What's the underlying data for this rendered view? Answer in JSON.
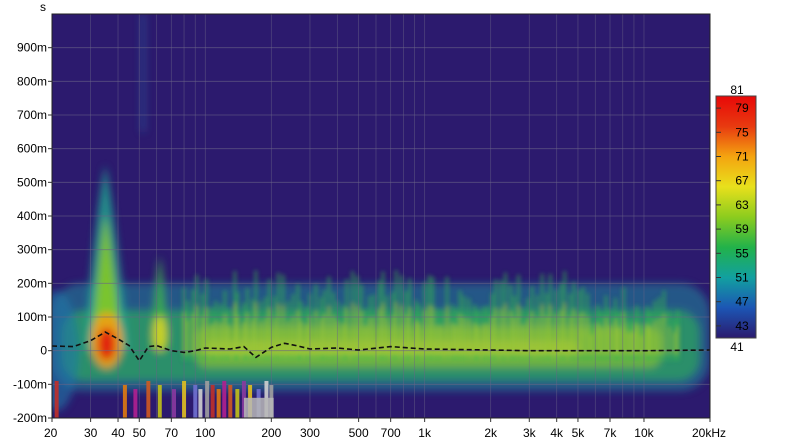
{
  "chart_data": {
    "type": "heatmap",
    "title": "",
    "xlabel": "",
    "ylabel": "s",
    "x_scale": "log",
    "xlim": [
      20,
      20000
    ],
    "ylim": [
      -0.2,
      1.0
    ],
    "x_ticks": [
      {
        "value": 20,
        "label": "20"
      },
      {
        "value": 30,
        "label": "30"
      },
      {
        "value": 40,
        "label": "40"
      },
      {
        "value": 50,
        "label": "50"
      },
      {
        "value": 70,
        "label": "70"
      },
      {
        "value": 100,
        "label": "100"
      },
      {
        "value": 200,
        "label": "200"
      },
      {
        "value": 300,
        "label": "300"
      },
      {
        "value": 500,
        "label": "500"
      },
      {
        "value": 700,
        "label": "700"
      },
      {
        "value": 1000,
        "label": "1k"
      },
      {
        "value": 2000,
        "label": "2k"
      },
      {
        "value": 3000,
        "label": "3k"
      },
      {
        "value": 4000,
        "label": "4k"
      },
      {
        "value": 5000,
        "label": "5k"
      },
      {
        "value": 7000,
        "label": "7k"
      },
      {
        "value": 10000,
        "label": "10k"
      },
      {
        "value": 20000,
        "label": "20kHz"
      }
    ],
    "y_ticks": [
      {
        "value": 0.9,
        "label": "900m"
      },
      {
        "value": 0.8,
        "label": "800m"
      },
      {
        "value": 0.7,
        "label": "700m"
      },
      {
        "value": 0.6,
        "label": "600m"
      },
      {
        "value": 0.5,
        "label": "500m"
      },
      {
        "value": 0.4,
        "label": "400m"
      },
      {
        "value": 0.3,
        "label": "300m"
      },
      {
        "value": 0.2,
        "label": "200m"
      },
      {
        "value": 0.1,
        "label": "100m"
      },
      {
        "value": 0.0,
        "label": "0"
      },
      {
        "value": -0.1,
        "label": "-100m"
      },
      {
        "value": -0.2,
        "label": "-200m"
      }
    ],
    "grid": true,
    "background_color": "#2c1a6e",
    "colorbar": {
      "min": 41,
      "max": 81,
      "min_label": "41",
      "max_label": "81",
      "tick_values": [
        79,
        75,
        71,
        67,
        63,
        59,
        55,
        51,
        47,
        43
      ],
      "tick_labels": [
        "79",
        "75",
        "71",
        "67",
        "63",
        "59",
        "55",
        "51",
        "47",
        "43"
      ],
      "colors": [
        "#2a1a6e",
        "#1c56b4",
        "#12a0a0",
        "#22b24a",
        "#8ccc1e",
        "#e8e01c",
        "#f4a410",
        "#e83a10",
        "#e80808"
      ]
    },
    "decay_contour": [
      {
        "f": 20,
        "t": 0.014
      },
      {
        "f": 25,
        "t": 0.012
      },
      {
        "f": 30,
        "t": 0.03
      },
      {
        "f": 35,
        "t": 0.055
      },
      {
        "f": 40,
        "t": 0.035
      },
      {
        "f": 45,
        "t": 0.015
      },
      {
        "f": 50,
        "t": -0.03
      },
      {
        "f": 55,
        "t": 0.012
      },
      {
        "f": 60,
        "t": 0.015
      },
      {
        "f": 70,
        "t": 0.0
      },
      {
        "f": 80,
        "t": -0.005
      },
      {
        "f": 90,
        "t": 0.0
      },
      {
        "f": 100,
        "t": 0.008
      },
      {
        "f": 130,
        "t": 0.005
      },
      {
        "f": 150,
        "t": 0.012
      },
      {
        "f": 170,
        "t": -0.02
      },
      {
        "f": 200,
        "t": 0.01
      },
      {
        "f": 230,
        "t": 0.022
      },
      {
        "f": 260,
        "t": 0.015
      },
      {
        "f": 300,
        "t": 0.005
      },
      {
        "f": 400,
        "t": 0.008
      },
      {
        "f": 500,
        "t": 0.002
      },
      {
        "f": 700,
        "t": 0.012
      },
      {
        "f": 1000,
        "t": 0.005
      },
      {
        "f": 2000,
        "t": 0.002
      },
      {
        "f": 3000,
        "t": 0.0
      },
      {
        "f": 5000,
        "t": 0.0
      },
      {
        "f": 7000,
        "t": 0.0
      },
      {
        "f": 10000,
        "t": 0.0
      },
      {
        "f": 20000,
        "t": 0.002
      }
    ]
  }
}
